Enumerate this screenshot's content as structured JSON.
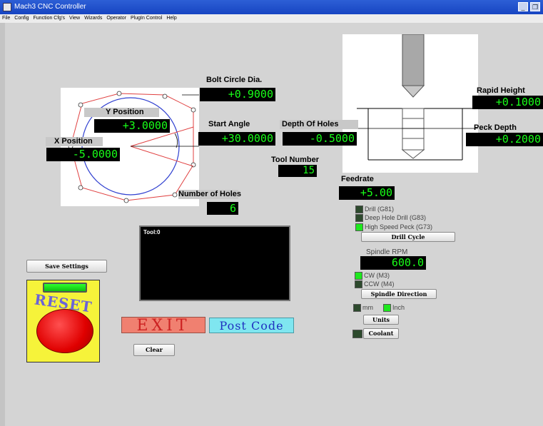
{
  "window": {
    "title": "Mach3 CNC Controller"
  },
  "menu": [
    "File",
    "Config",
    "Function Cfg's",
    "View",
    "Wizards",
    "Operator",
    "PlugIn Control",
    "Help"
  ],
  "fields": {
    "bolt_circle_dia": {
      "label": "Bolt Circle Dia.",
      "value": "+0.9000"
    },
    "y_position": {
      "label": "Y Position",
      "value": "+3.0000"
    },
    "x_position": {
      "label": "X Position",
      "value": "-5.0000"
    },
    "start_angle": {
      "label": "Start Angle",
      "value": "+30.0000"
    },
    "depth_of_holes": {
      "label": "Depth Of Holes",
      "value": "-0.5000"
    },
    "tool_number": {
      "label": "Tool Number",
      "value": "15"
    },
    "number_of_holes": {
      "label": "Number of Holes",
      "value": "6"
    },
    "rapid_height": {
      "label": "Rapid Height",
      "value": "+0.1000"
    },
    "peck_depth": {
      "label": "Peck Depth",
      "value": "+0.2000"
    },
    "feedrate": {
      "label": "Feedrate",
      "value": "+5.00"
    },
    "spindle_rpm": {
      "label": "Spindle RPM",
      "value": "600.0"
    }
  },
  "drill_options": [
    {
      "label": "Drill (G81)",
      "state": "off"
    },
    {
      "label": "Deep Hole Drill (G83)",
      "state": "off"
    },
    {
      "label": "High Speed Peck (G73)",
      "state": "on"
    }
  ],
  "spindle_dir_options": [
    {
      "label": "CW (M3)",
      "state": "on"
    },
    {
      "label": "CCW (M4)",
      "state": "off"
    }
  ],
  "units": {
    "mm": "mm",
    "inch": "Inch"
  },
  "buttons": {
    "drill_cycle": "Drill Cycle",
    "spindle_direction": "Spindle Direction",
    "units": "Units",
    "coolant": "Coolant",
    "save_settings": "Save Settings",
    "exit": "EXIT",
    "post_code": "Post Code",
    "clear": "Clear",
    "reset": "RESET"
  },
  "gcode_box": {
    "text": "Tool:0"
  },
  "colors": {
    "lcd_text": "#18ff18",
    "led_on": "#1ee81e",
    "exit_bg": "#f08070",
    "post_bg": "#7fe6f0"
  }
}
